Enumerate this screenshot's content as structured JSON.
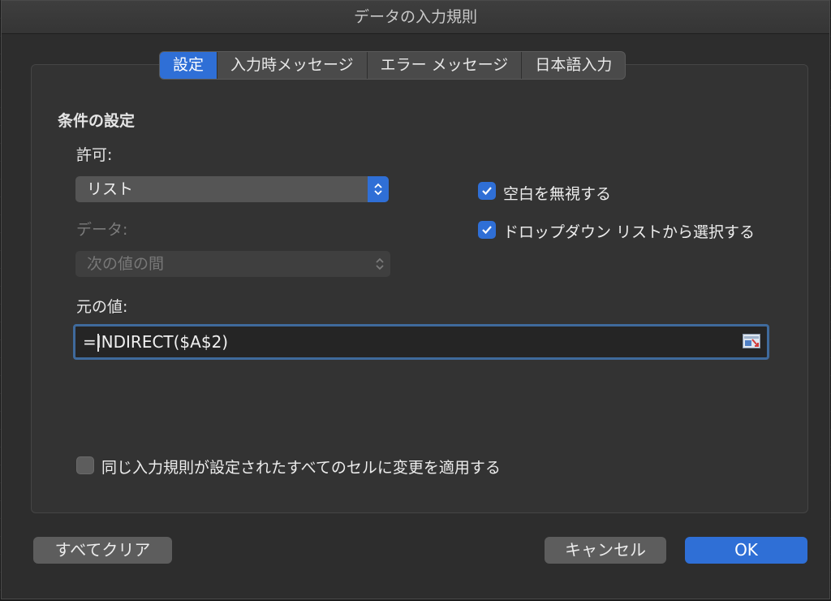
{
  "dialog": {
    "title": "データの入力規則"
  },
  "tabs": [
    {
      "label": "設定",
      "active": true
    },
    {
      "label": "入力時メッセージ",
      "active": false
    },
    {
      "label": "エラー メッセージ",
      "active": false
    },
    {
      "label": "日本語入力",
      "active": false
    }
  ],
  "criteria": {
    "section_title": "条件の設定",
    "allow_label": "許可:",
    "allow_value": "リスト",
    "data_label": "データ:",
    "data_value": "次の値の間",
    "source_label": "元の値:",
    "source_value": "=INDIRECT($A$2)"
  },
  "options": {
    "ignore_blank": {
      "label": "空白を無視する",
      "checked": true
    },
    "in_cell_dropdown": {
      "label": "ドロップダウン リストから選択する",
      "checked": true
    },
    "apply_all": {
      "label": "同じ入力規則が設定されたすべてのセルに変更を適用する",
      "checked": false
    }
  },
  "buttons": {
    "clear_all": "すべてクリア",
    "cancel": "キャンセル",
    "ok": "OK"
  },
  "colors": {
    "accent": "#2f6fd6",
    "panel": "#333333",
    "dialog": "#2d2d2d"
  }
}
